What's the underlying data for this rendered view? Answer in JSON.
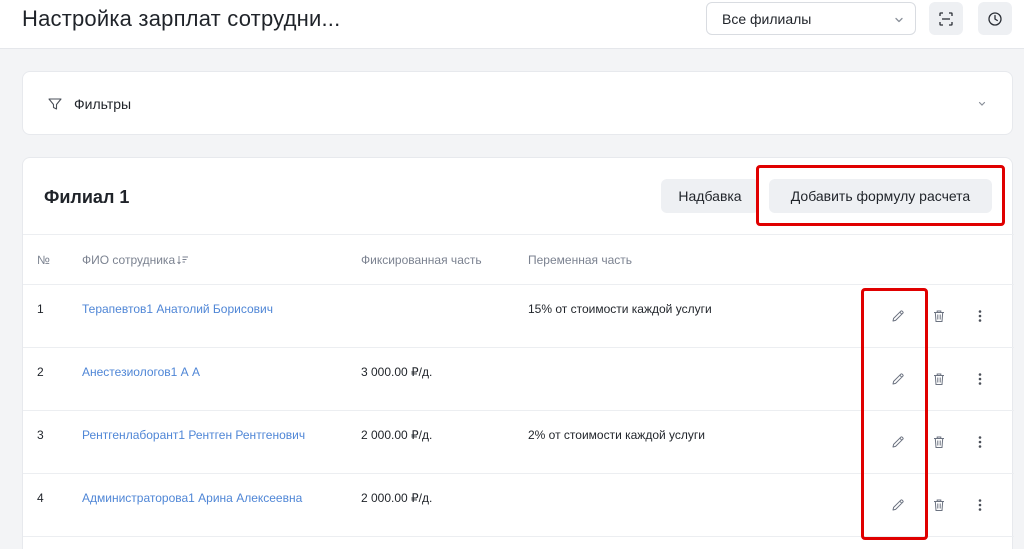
{
  "header": {
    "title": "Настройка зарплат сотрудни...",
    "branch_select": {
      "value": "Все филиалы"
    },
    "icons": [
      "scan-icon",
      "clock-icon"
    ]
  },
  "filters": {
    "label": "Фильтры"
  },
  "branch": {
    "title": "Филиал 1",
    "bonus_button": "Надбавка",
    "add_formula_button": "Добавить формулу расчета"
  },
  "table": {
    "columns": {
      "num": "№",
      "name": "ФИО сотрудника",
      "fixed": "Фиксированная часть",
      "variable": "Переменная часть"
    },
    "rows": [
      {
        "num": "1",
        "name": "Терапевтов1 Анатолий Борисович",
        "fixed": "",
        "variable": "15% от стоимости каждой услуги"
      },
      {
        "num": "2",
        "name": "Анестезиологов1 А А",
        "fixed": "3 000.00 ₽/д.",
        "variable": ""
      },
      {
        "num": "3",
        "name": "Рентгенлаборант1 Рентген Рентгенович",
        "fixed": "2 000.00 ₽/д.",
        "variable": "2% от стоимости каждой услуги"
      },
      {
        "num": "4",
        "name": "Администраторова1 Арина Алексеевна",
        "fixed": "2 000.00 ₽/д.",
        "variable": ""
      }
    ],
    "row_action_icons": [
      "pencil-icon",
      "trash-icon",
      "more-vertical-icon"
    ]
  },
  "colors": {
    "link": "#4f86d6",
    "highlight": "#e00000",
    "button_bg": "#eef0f3"
  }
}
